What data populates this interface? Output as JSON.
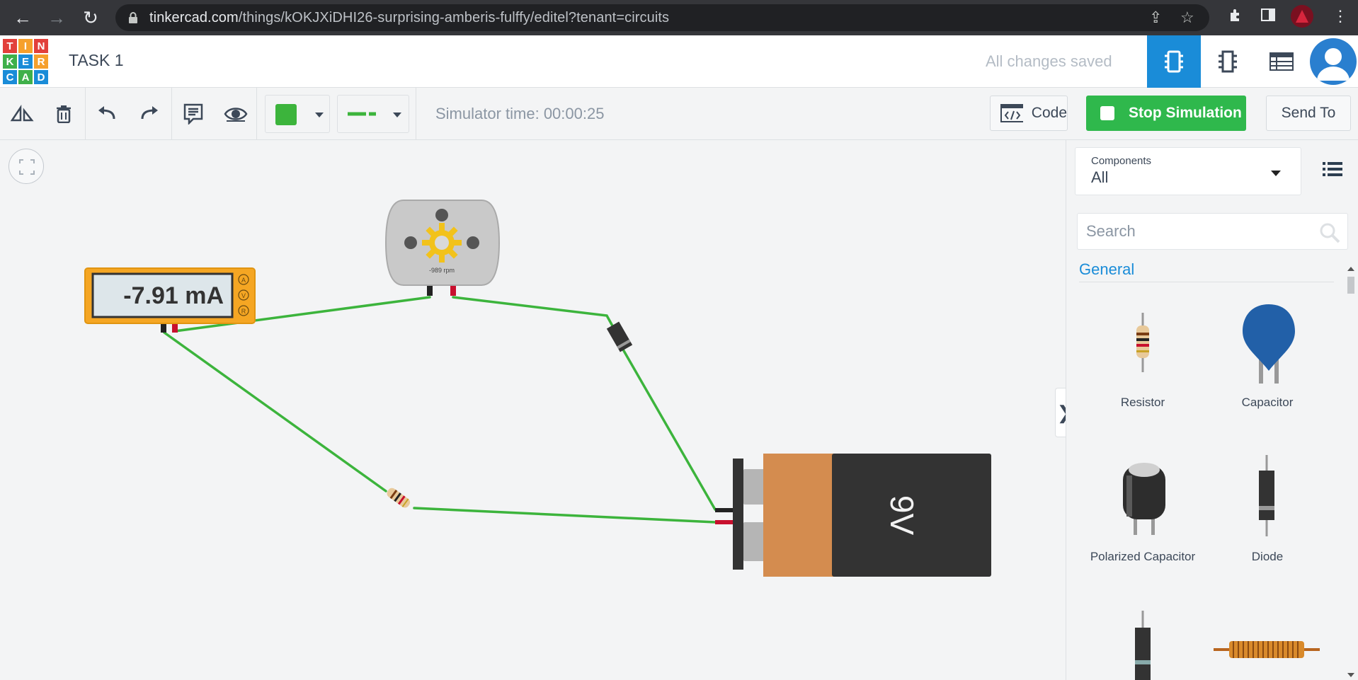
{
  "browser": {
    "url_host": "tinkercad.com",
    "url_path": "/things/kOKJXiDHI26-surprising-amberis-fulffy/editel?tenant=circuits"
  },
  "app": {
    "logo_letters": [
      "T",
      "I",
      "N",
      "K",
      "E",
      "R",
      "C",
      "A",
      "D"
    ],
    "title": "TASK 1",
    "save_status": "All changes saved"
  },
  "toolbar": {
    "simulator_time": "Simulator time: 00:00:25",
    "code_label": "Code",
    "stop_label": "Stop Simulation",
    "send_label": "Send To",
    "wire_color": "#3cb43c"
  },
  "circuit": {
    "multimeter_reading": "-7.91 mA",
    "multimeter_modes": [
      "A",
      "V",
      "R"
    ],
    "motor_rpm": "-989 rpm",
    "battery_label": "9V"
  },
  "panel": {
    "components_label": "Components",
    "components_value": "All",
    "search_placeholder": "Search",
    "section_title": "General",
    "items": [
      {
        "label": "Resistor"
      },
      {
        "label": "Capacitor"
      },
      {
        "label": "Polarized Capacitor"
      },
      {
        "label": "Diode"
      }
    ]
  }
}
